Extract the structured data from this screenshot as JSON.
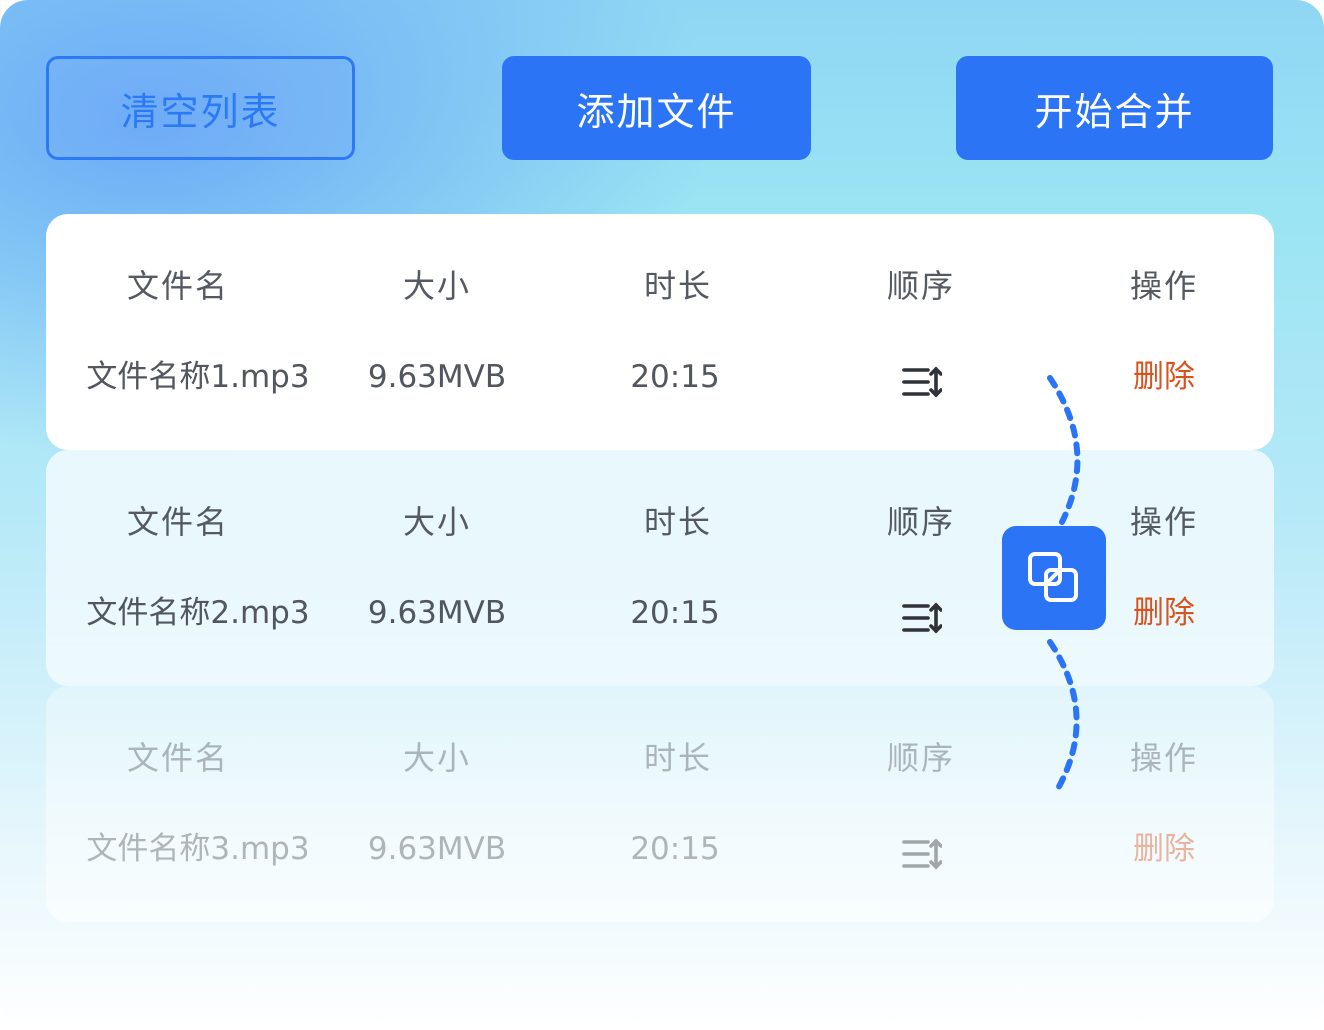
{
  "toolbar": {
    "clear_label": "清空列表",
    "add_label": "添加文件",
    "merge_label": "开始合并"
  },
  "columns": [
    "文件名",
    "大小",
    "时长",
    "顺序",
    "操作"
  ],
  "files": [
    {
      "name": "文件名称1.mp3",
      "size": "9.63MVB",
      "duration": "20:15",
      "action": "删除"
    },
    {
      "name": "文件名称2.mp3",
      "size": "9.63MVB",
      "duration": "20:15",
      "action": "删除"
    },
    {
      "name": "文件名称3.mp3",
      "size": "9.63MVB",
      "duration": "20:15",
      "action": "删除"
    }
  ],
  "icons": {
    "order": "reorder-icon",
    "merge": "merge-icon"
  },
  "colors": {
    "accent": "#2b74f5",
    "delete": "#d9531e",
    "text": "#52565e"
  }
}
